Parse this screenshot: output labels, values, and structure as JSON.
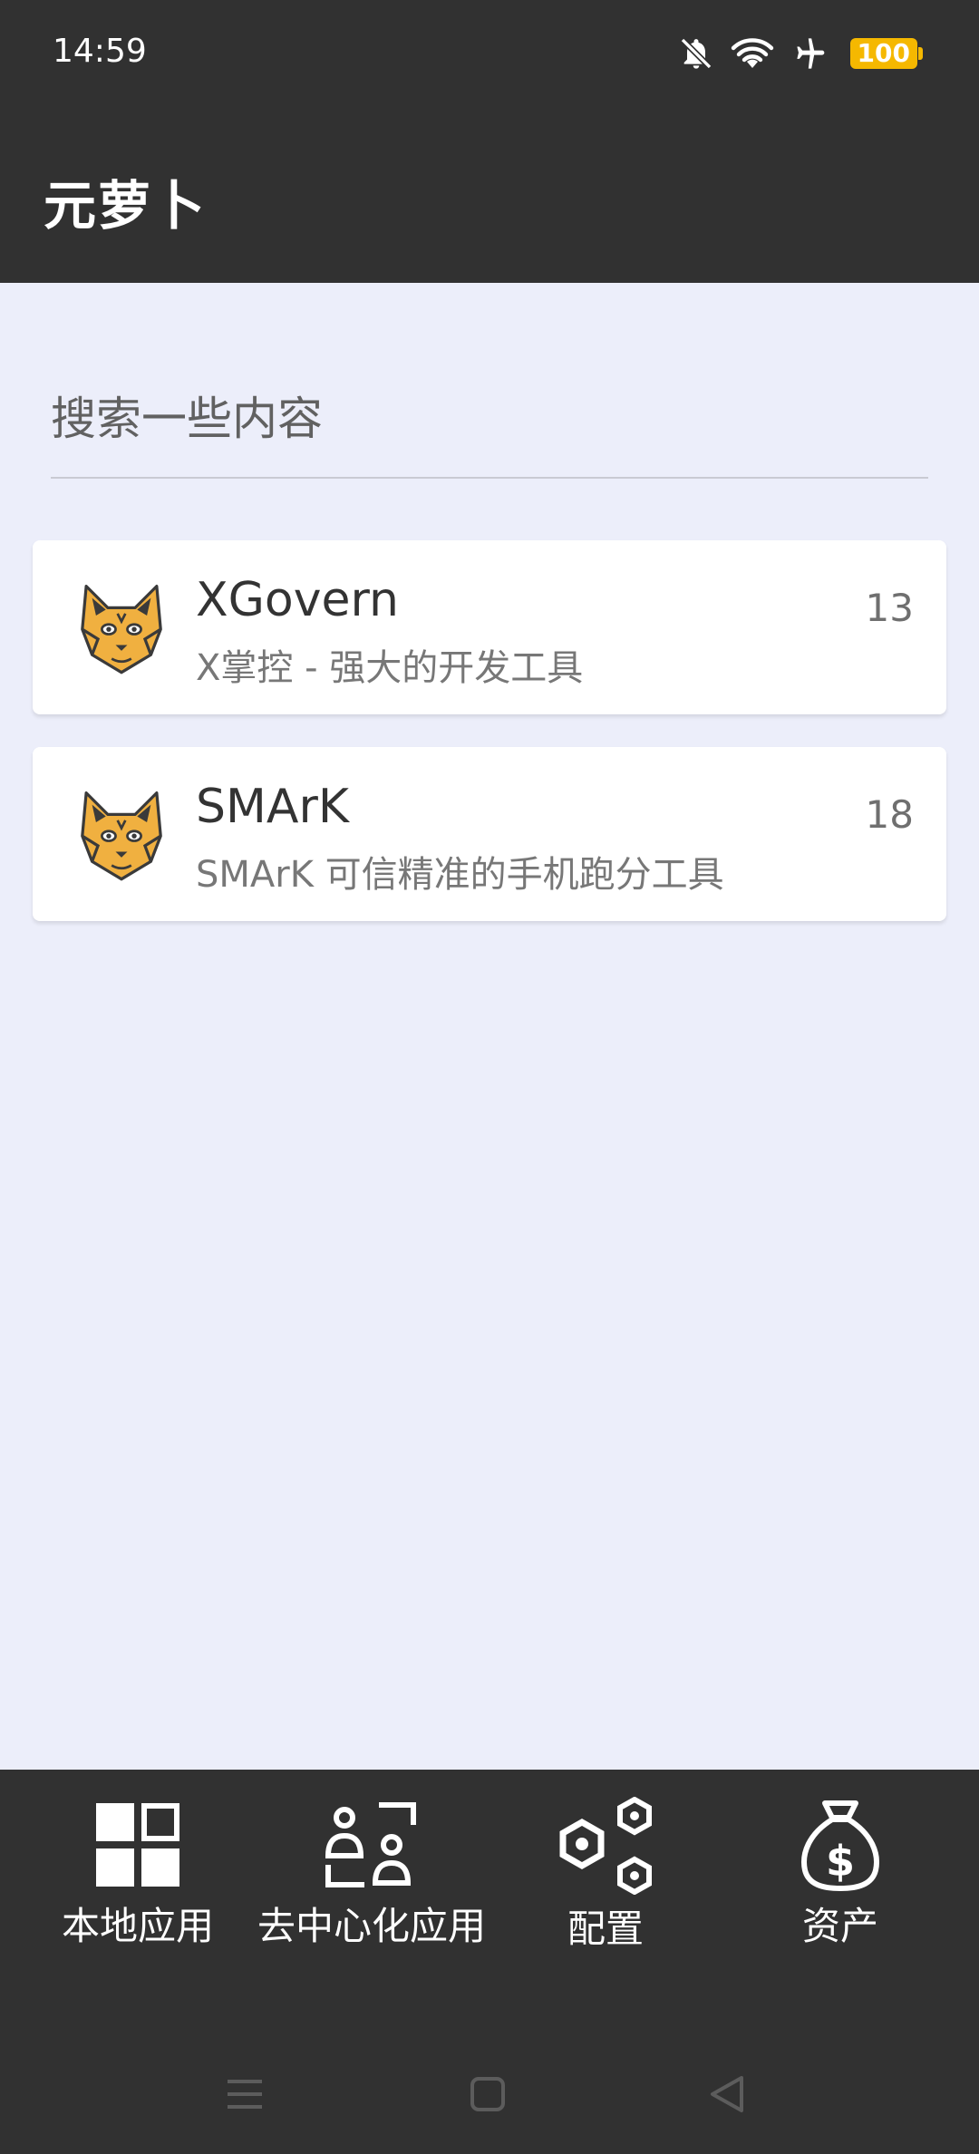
{
  "status_bar": {
    "time": "14:59",
    "icons": [
      "bell-off-icon",
      "wifi-icon",
      "airplane-icon",
      "battery-icon"
    ],
    "battery": "100"
  },
  "app_bar": {
    "title": "元萝卜"
  },
  "search": {
    "placeholder": "搜索一些内容",
    "value": ""
  },
  "apps": [
    {
      "name": "XGovern",
      "description": "X掌控 - 强大的开发工具",
      "count": "13",
      "icon": "lynx-icon"
    },
    {
      "name": "SMArK",
      "description": "SMArK 可信精准的手机跑分工具",
      "count": "18",
      "icon": "lynx-icon"
    }
  ],
  "bottom_nav": [
    {
      "label": "本地应用",
      "icon": "grid-icon"
    },
    {
      "label": "去中心化应用",
      "icon": "decentralized-icon"
    },
    {
      "label": "配置",
      "icon": "hexagons-icon"
    },
    {
      "label": "资产",
      "icon": "money-bag-icon"
    }
  ],
  "system_nav": [
    "menu-icon",
    "home-icon",
    "back-icon"
  ],
  "colors": {
    "bar_bg": "#313131",
    "content_bg": "#eceefa",
    "card_bg": "#ffffff",
    "battery": "#f5b800",
    "lynx": "#f0b040"
  }
}
